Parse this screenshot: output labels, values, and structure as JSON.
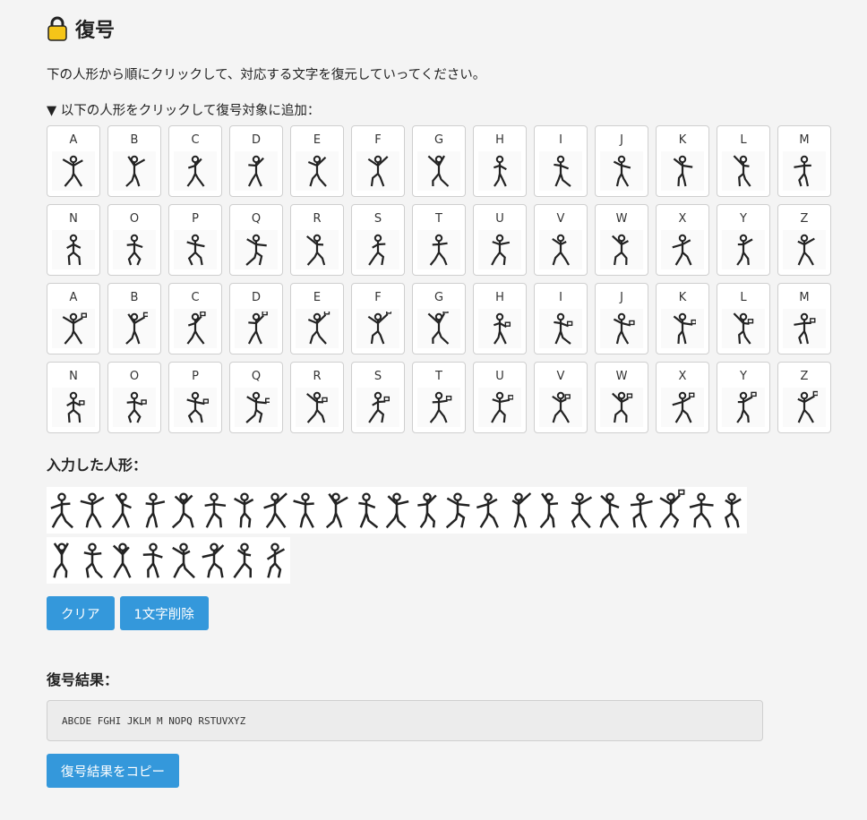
{
  "header": {
    "title": "復号",
    "icon": "lock-icon"
  },
  "intro": "下の人形から順にクリックして、対応する文字を復元していってください。",
  "instruction": "▼ 以下の人形をクリックして復号対象に追加：",
  "grid": {
    "row1": [
      "A",
      "B",
      "C",
      "D",
      "E",
      "F",
      "G",
      "H",
      "I",
      "J",
      "K",
      "L",
      "M"
    ],
    "row2": [
      "N",
      "O",
      "P",
      "Q",
      "R",
      "S",
      "T",
      "U",
      "V",
      "W",
      "X",
      "Y",
      "Z"
    ],
    "row3": [
      "A",
      "B",
      "C",
      "D",
      "E",
      "F",
      "G",
      "H",
      "I",
      "J",
      "K",
      "L",
      "M"
    ],
    "row4": [
      "N",
      "O",
      "P",
      "Q",
      "R",
      "S",
      "T",
      "U",
      "V",
      "W",
      "X",
      "Y",
      "Z"
    ]
  },
  "input_section": {
    "title": "入力した人形：",
    "count": 31
  },
  "buttons": {
    "clear": "クリア",
    "delete_one": "1文字削除"
  },
  "result": {
    "title": "復号結果：",
    "value": "ABCDE FGHI JKLM M NOPQ RSTUVXYZ",
    "copy": "復号結果をコピー"
  },
  "colors": {
    "accent": "#3498db",
    "figure": "#222222",
    "lock": "#f5c518"
  }
}
